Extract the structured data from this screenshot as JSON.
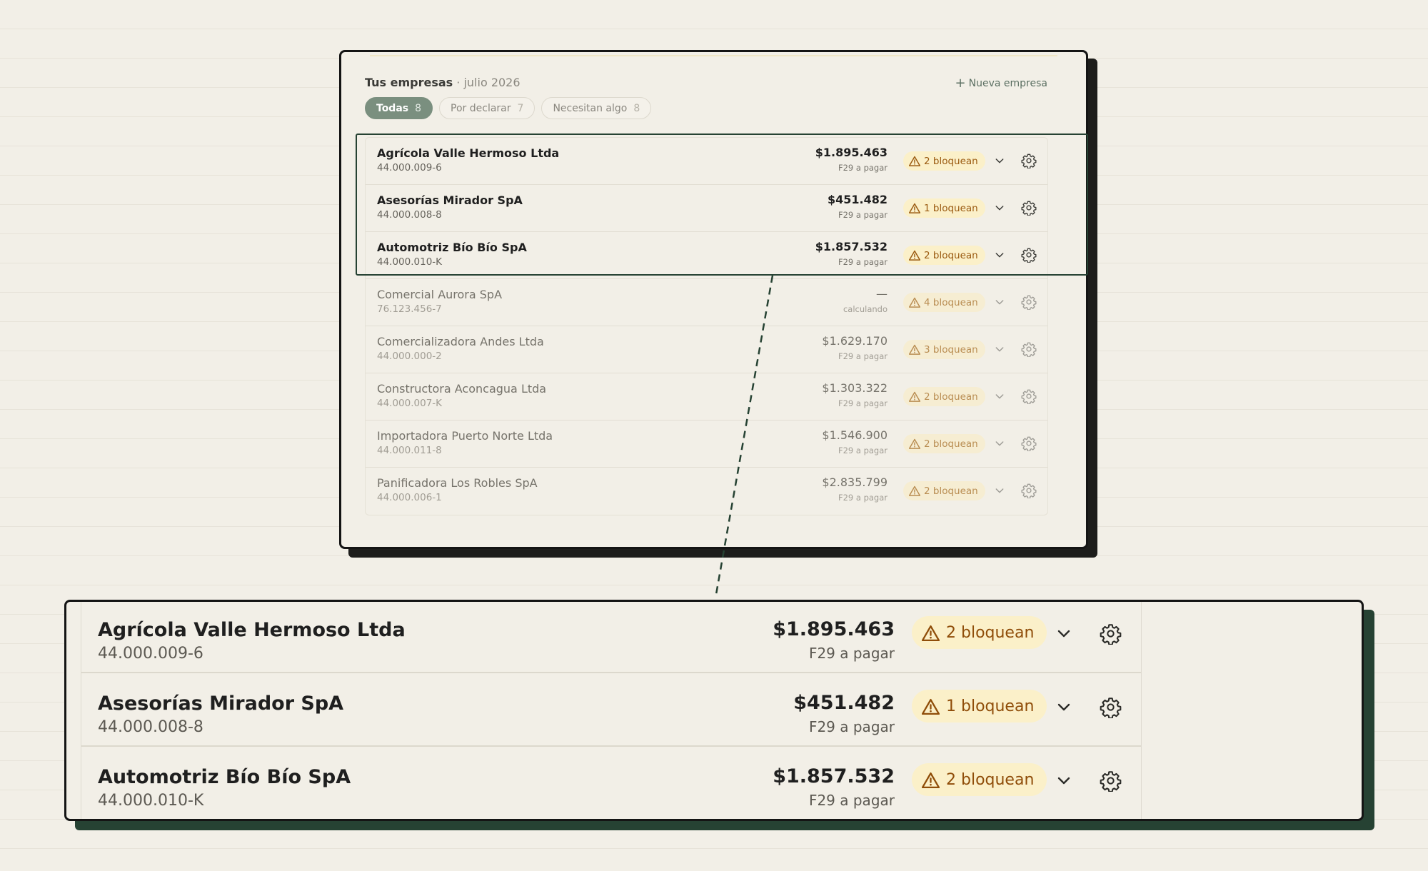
{
  "header": {
    "title": "Tus empresas",
    "period": "· julio 2026",
    "new_company_label": "Nueva empresa"
  },
  "filters": [
    {
      "label": "Todas",
      "count": "8",
      "active": true
    },
    {
      "label": "Por declarar",
      "count": "7",
      "active": false
    },
    {
      "label": "Necesitan algo",
      "count": "8",
      "active": false
    }
  ],
  "companies": [
    {
      "name": "Agrícola Valle Hermoso Ltda",
      "rut": "44.000.009-6",
      "amount": "$1.895.463",
      "amount_label": "F29 a pagar",
      "badge": "2 bloquean"
    },
    {
      "name": "Asesorías Mirador SpA",
      "rut": "44.000.008-8",
      "amount": "$451.482",
      "amount_label": "F29 a pagar",
      "badge": "1 bloquean"
    },
    {
      "name": "Automotriz Bío Bío SpA",
      "rut": "44.000.010-K",
      "amount": "$1.857.532",
      "amount_label": "F29 a pagar",
      "badge": "2 bloquean"
    },
    {
      "name": "Comercial Aurora SpA",
      "rut": "76.123.456-7",
      "amount": "—",
      "amount_label": "calculando",
      "badge": "4 bloquean"
    },
    {
      "name": "Comercializadora Andes Ltda",
      "rut": "44.000.000-2",
      "amount": "$1.629.170",
      "amount_label": "F29 a pagar",
      "badge": "3 bloquean"
    },
    {
      "name": "Constructora Aconcagua Ltda",
      "rut": "44.000.007-K",
      "amount": "$1.303.322",
      "amount_label": "F29 a pagar",
      "badge": "2 bloquean"
    },
    {
      "name": "Importadora Puerto Norte Ltda",
      "rut": "44.000.011-8",
      "amount": "$1.546.900",
      "amount_label": "F29 a pagar",
      "badge": "2 bloquean"
    },
    {
      "name": "Panificadora Los Robles SpA",
      "rut": "44.000.006-1",
      "amount": "$2.835.799",
      "amount_label": "F29 a pagar",
      "badge": "2 bloquean"
    }
  ],
  "icons": {
    "new": "plus-icon",
    "badge": "warning-triangle-icon",
    "expand": "chevron-down-icon",
    "settings": "gear-icon"
  },
  "colors": {
    "background": "#f2efe7",
    "accent_green": "#264233",
    "pill_active": "#7a8f7f",
    "badge_bg": "#fbf0c9",
    "badge_text": "#9a5a10"
  }
}
